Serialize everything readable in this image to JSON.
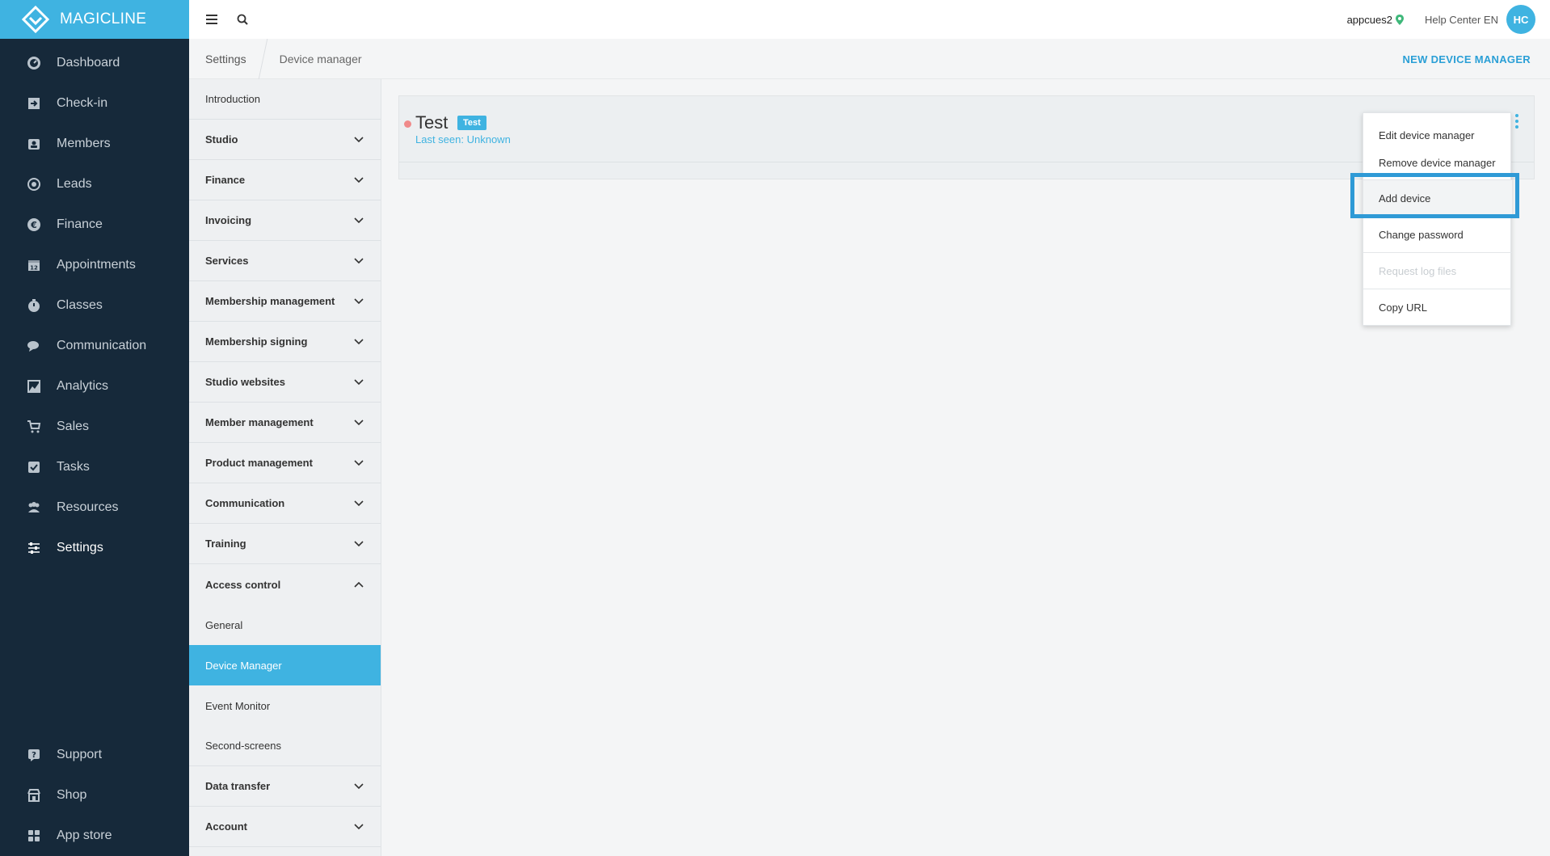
{
  "brand": {
    "name": "MAGICLINE",
    "logo_icon": "diamond-logo-icon"
  },
  "nav": {
    "items": [
      {
        "label": "Dashboard",
        "icon": "dashboard-icon"
      },
      {
        "label": "Check-in",
        "icon": "checkin-icon"
      },
      {
        "label": "Members",
        "icon": "members-icon"
      },
      {
        "label": "Leads",
        "icon": "leads-icon"
      },
      {
        "label": "Finance",
        "icon": "finance-icon"
      },
      {
        "label": "Appointments",
        "icon": "calendar-icon"
      },
      {
        "label": "Classes",
        "icon": "timer-icon"
      },
      {
        "label": "Communication",
        "icon": "chat-icon"
      },
      {
        "label": "Analytics",
        "icon": "analytics-icon"
      },
      {
        "label": "Sales",
        "icon": "cart-icon"
      },
      {
        "label": "Tasks",
        "icon": "checkbox-icon"
      },
      {
        "label": "Resources",
        "icon": "resources-icon"
      },
      {
        "label": "Settings",
        "icon": "sliders-icon"
      }
    ],
    "bottom_items": [
      {
        "label": "Support",
        "icon": "support-icon"
      },
      {
        "label": "Shop",
        "icon": "shop-icon"
      },
      {
        "label": "App store",
        "icon": "grid-icon"
      }
    ]
  },
  "topbar": {
    "user": "appcues2",
    "help": "Help Center EN",
    "avatar_initials": "HC"
  },
  "breadcrumb": {
    "items": [
      "Settings",
      "Device manager"
    ],
    "action_label": "NEW DEVICE MANAGER"
  },
  "submenu": {
    "items": [
      {
        "label": "Introduction"
      },
      {
        "label": "Studio"
      },
      {
        "label": "Finance"
      },
      {
        "label": "Invoicing"
      },
      {
        "label": "Services"
      },
      {
        "label": "Membership management"
      },
      {
        "label": "Membership signing"
      },
      {
        "label": "Studio websites"
      },
      {
        "label": "Member management"
      },
      {
        "label": "Product management"
      },
      {
        "label": "Communication"
      },
      {
        "label": "Training"
      },
      {
        "label": "Access control"
      },
      {
        "label": "General"
      },
      {
        "label": "Device Manager"
      },
      {
        "label": "Event Monitor"
      },
      {
        "label": "Second-screens"
      },
      {
        "label": "Data transfer"
      },
      {
        "label": "Account"
      }
    ]
  },
  "device_manager": {
    "name": "Test",
    "badge": "Test",
    "last_seen": "Last seen: Unknown",
    "status_color": "#f08a8a"
  },
  "dropdown": {
    "items": [
      {
        "label": "Edit device manager"
      },
      {
        "label": "Remove device manager"
      },
      {
        "label": "Add device"
      },
      {
        "label": "Change password"
      },
      {
        "label": "Request log files"
      },
      {
        "label": "Copy URL"
      }
    ]
  },
  "colors": {
    "accent": "#3fb3e1",
    "nav_bg": "#16293a",
    "highlight_border": "#2f9ad6"
  }
}
